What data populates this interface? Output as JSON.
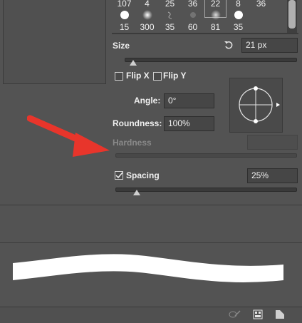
{
  "presets": {
    "top_row": [
      "107",
      "4",
      "25",
      "36",
      "22",
      "8",
      "36"
    ],
    "bottom_row": [
      "15",
      "300",
      "35",
      "60",
      "81",
      "35"
    ]
  },
  "size": {
    "label": "Size",
    "value": "21 px",
    "reset_icon": "reset-icon",
    "slider_fraction": 0.1
  },
  "flip": {
    "x_label": "Flip X",
    "y_label": "Flip Y"
  },
  "angle": {
    "label": "Angle:",
    "value": "0°"
  },
  "roundness": {
    "label": "Roundness:",
    "value": "100%"
  },
  "hardness": {
    "label": "Hardness",
    "value": ""
  },
  "spacing": {
    "label": "Spacing",
    "value": "25%",
    "checked": true,
    "slider_fraction": 0.12
  },
  "annotation": {
    "arrow_color": "#e8352b"
  },
  "footer": {
    "icons": [
      "brush-settings-icon",
      "grid-icon",
      "new-preset-icon"
    ]
  }
}
